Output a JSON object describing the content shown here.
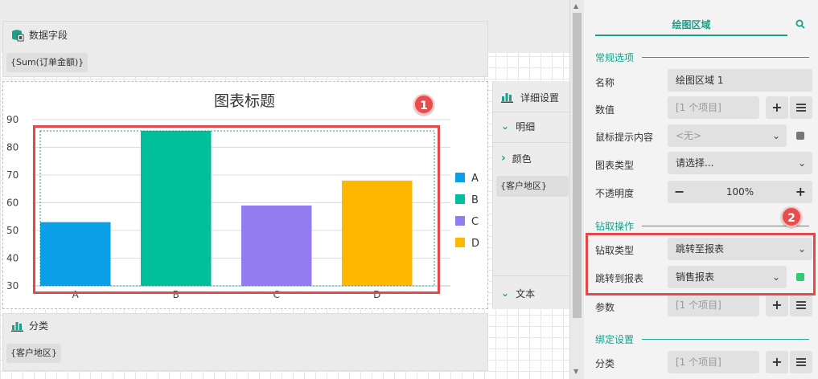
{
  "canvas": {
    "data_field": {
      "title": "数据字段",
      "chip": "{Sum(订单金额)}"
    },
    "category": {
      "title": "分类",
      "chip": "{客户地区}"
    },
    "detail_panel": {
      "settings": "详细设置",
      "detail": "明细",
      "color": "颜色",
      "color_chip": "{客户地区}",
      "text": "文本"
    }
  },
  "chart_data": {
    "type": "bar",
    "title": "图表标题",
    "categories": [
      "A",
      "B",
      "C",
      "D"
    ],
    "values": [
      53,
      86,
      59,
      68
    ],
    "ylim": [
      30,
      90
    ],
    "yticks": [
      30,
      40,
      50,
      60,
      70,
      80,
      90
    ],
    "colors": [
      "#0aa0e8",
      "#00bf9a",
      "#937cf2",
      "#ffb800"
    ],
    "legend": [
      "A",
      "B",
      "C",
      "D"
    ],
    "legend_position": "right",
    "grid": true
  },
  "panel": {
    "title": "绘图区域",
    "general": {
      "header": "常规选项",
      "name_label": "名称",
      "name_value": "绘图区域 1",
      "value_label": "数值",
      "value_value": "[1 个项目]",
      "tooltip_label": "鼠标提示内容",
      "tooltip_value": "<无>",
      "type_label": "图表类型",
      "type_value": "请选择...",
      "opacity_label": "不透明度",
      "opacity_value": "100%"
    },
    "drill": {
      "header": "钻取操作",
      "type_label": "钻取类型",
      "type_value": "跳转至报表",
      "target_label": "跳转到报表",
      "target_value": "销售报表",
      "param_label": "参数",
      "param_value": "[1 个项目]"
    },
    "binding": {
      "header": "绑定设置",
      "category_label": "分类",
      "category_value": "[1 个项目]"
    }
  },
  "annotations": {
    "badge1": "1",
    "badge2": "2"
  },
  "colors": {
    "accent": "#1a9f8a",
    "annotation": "#e24a4a",
    "indicator": "#2ecc71",
    "indicator_off": "#777777"
  }
}
